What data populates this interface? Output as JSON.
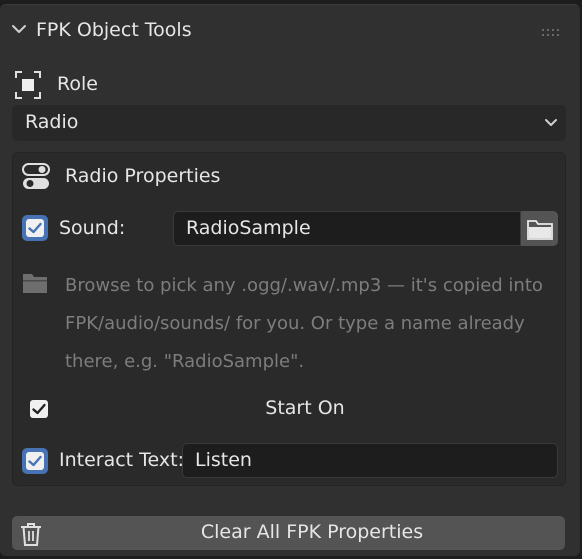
{
  "panel": {
    "title": "FPK Object Tools"
  },
  "role": {
    "label": "Role",
    "selected": "Radio"
  },
  "radio_properties": {
    "title": "Radio Properties",
    "sound": {
      "label": "Sound:",
      "checked": true,
      "value": "RadioSample"
    },
    "info": "Browse to pick any .ogg/.wav/.mp3 — it's copied into FPK/audio/sounds/ for you. Or type a name already there, e.g. \"RadioSample\".",
    "start_on": {
      "label": "Start On",
      "checked": true
    },
    "interact_text": {
      "label": "Interact Text:",
      "checked": true,
      "value": "Listen"
    }
  },
  "actions": {
    "clear_label": "Clear All FPK Properties"
  },
  "colors": {
    "background": "#303030",
    "checkbox_accent": "#4772b3",
    "button": "#545454",
    "field": "#1d1d1d"
  },
  "icons": [
    "chevron-down-icon",
    "grip-icon",
    "object-role-icon",
    "toggle-icon",
    "folder-icon",
    "trash-icon",
    "checkmark-icon"
  ]
}
